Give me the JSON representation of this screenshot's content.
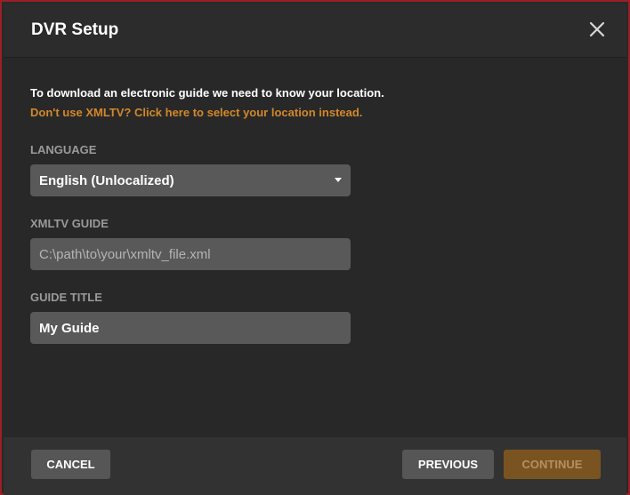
{
  "dialog": {
    "title": "DVR Setup"
  },
  "content": {
    "intro_text": "To download an electronic guide we need to know your location.",
    "location_link": "Don't use XMLTV? Click here to select your location instead.",
    "language": {
      "label": "LANGUAGE",
      "selected": "English (Unlocalized)"
    },
    "xmltv_guide": {
      "label": "XMLTV GUIDE",
      "value": "",
      "placeholder": "C:\\path\\to\\your\\xmltv_file.xml"
    },
    "guide_title": {
      "label": "GUIDE TITLE",
      "value": "My Guide"
    }
  },
  "footer": {
    "cancel_label": "CANCEL",
    "previous_label": "PREVIOUS",
    "continue_label": "CONTINUE"
  },
  "colors": {
    "accent": "#d3882a",
    "continue_bg": "#7a5420",
    "border": "#9b1f24"
  },
  "icons": {
    "close": "close-icon",
    "dropdown": "chevron-down-icon"
  }
}
